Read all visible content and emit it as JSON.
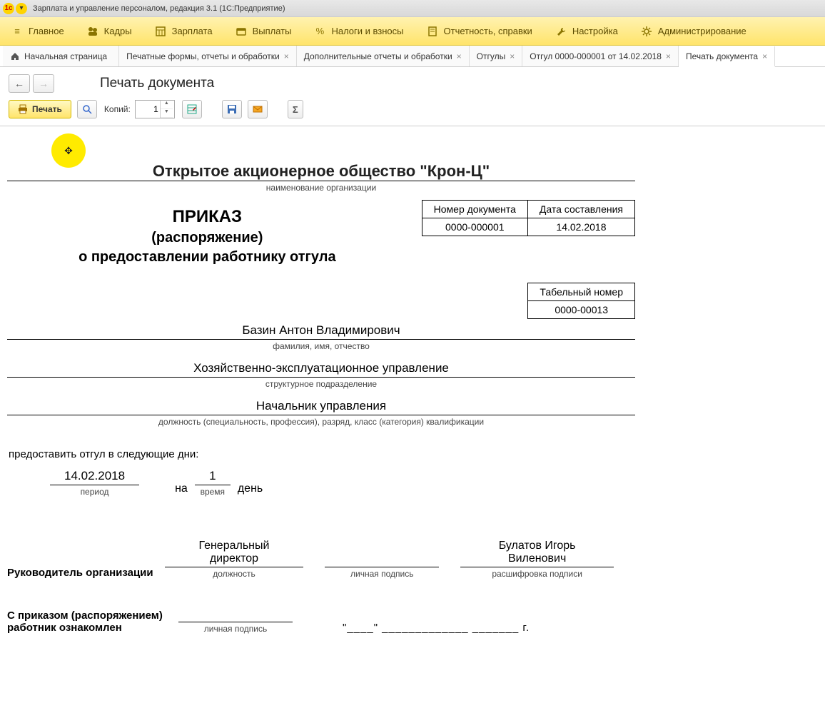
{
  "window": {
    "title": "Зарплата и управление персоналом, редакция 3.1  (1С:Предприятие)"
  },
  "menu": {
    "items": [
      {
        "label": "Главное",
        "icon": "menu"
      },
      {
        "label": "Кадры",
        "icon": "people"
      },
      {
        "label": "Зарплата",
        "icon": "calc"
      },
      {
        "label": "Выплаты",
        "icon": "wallet"
      },
      {
        "label": "Налоги и взносы",
        "icon": "percent"
      },
      {
        "label": "Отчетность, справки",
        "icon": "report"
      },
      {
        "label": "Настройка",
        "icon": "wrench"
      },
      {
        "label": "Администрирование",
        "icon": "gear"
      }
    ]
  },
  "tabs": {
    "home": "Начальная страница",
    "items": [
      {
        "label": "Печатные формы, отчеты и обработки"
      },
      {
        "label": "Дополнительные отчеты и обработки"
      },
      {
        "label": "Отгулы"
      },
      {
        "label": "Отгул 0000-000001 от 14.02.2018"
      },
      {
        "label": "Печать документа",
        "active": true
      }
    ]
  },
  "page": {
    "title": "Печать документа"
  },
  "toolbar": {
    "print": "Печать",
    "copies_label": "Копий:",
    "copies_value": "1"
  },
  "doc": {
    "org_name": "Открытое акционерное общество \"Крон-Ц\"",
    "org_sublabel": "наименование организации",
    "meta": {
      "num_header": "Номер документа",
      "date_header": "Дата составления",
      "num": "0000-000001",
      "date": "14.02.2018"
    },
    "title1": "ПРИКАЗ",
    "title2": "(распоряжение)",
    "title3": "о предоставлении работнику отгула",
    "tabno": {
      "header": "Табельный номер",
      "value": "0000-00013"
    },
    "fio": {
      "value": "Базин Антон Владимирович",
      "sublabel": "фамилия, имя, отчество"
    },
    "dept": {
      "value": "Хозяйственно-эксплуатационное управление",
      "sublabel": "структурное подразделение"
    },
    "post": {
      "value": "Начальник управления",
      "sublabel": "должность (специальность, профессия), разряд, класс (категория) квалификации"
    },
    "sentence": "предоставить отгул в следующие дни:",
    "period": {
      "value": "14.02.2018",
      "sublabel": "период",
      "na": "на",
      "days": "1",
      "days_sublabel": "время",
      "days_word": "день"
    },
    "head": {
      "label": "Руководитель организации",
      "position": "Генеральный директор",
      "pos_sub": "должность",
      "sign_sub": "личная подпись",
      "name": "Булатов Игорь Виленович",
      "name_sub": "расшифровка подписи"
    },
    "ack": {
      "label1": "С приказом (распоряжением)",
      "label2": "работник ознакомлен",
      "sign_sub": "личная подпись",
      "dateblank": "\"____\" _____________ _______ г."
    }
  }
}
